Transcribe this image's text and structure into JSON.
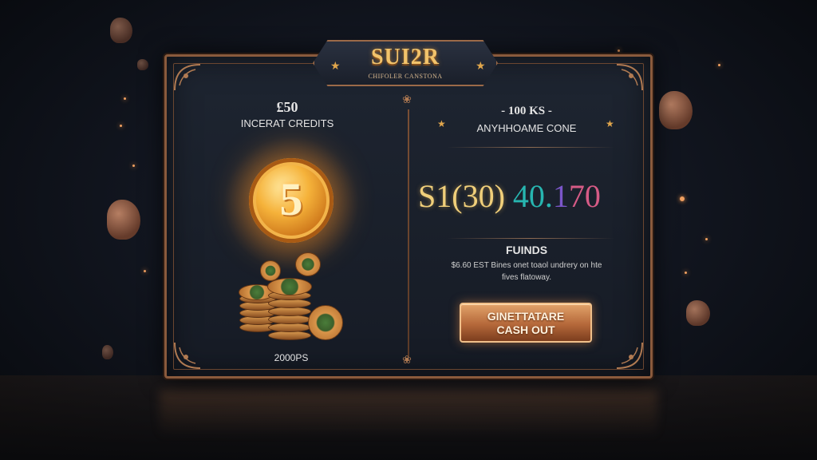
{
  "header": {
    "brand": "SUI2R",
    "tagline": "CHIFOLER CANSTONA"
  },
  "left_panel": {
    "amount": "£50",
    "label": "INCERAT CREDITS",
    "coin_symbol": "5",
    "footer": "2000PS"
  },
  "right_panel": {
    "title": "- 100 KS -",
    "subtitle": "ANYHHOAME CONE",
    "balance": {
      "part_gold": "S1(30)",
      "part_teal": "40.",
      "part_violet": "1",
      "part_pink": "70"
    },
    "funds_label": "FUINDS",
    "funds_desc_line1": "$6.60 EST Bines onet toaol undrery on hte",
    "funds_desc_line2": "fives flatoway.",
    "cashout_line1": "GINETTATARE",
    "cashout_line2": "CASH OUT"
  },
  "colors": {
    "accent_gold": "#f2c36b",
    "frame": "#8a5a3c",
    "button": "#c07a44"
  }
}
